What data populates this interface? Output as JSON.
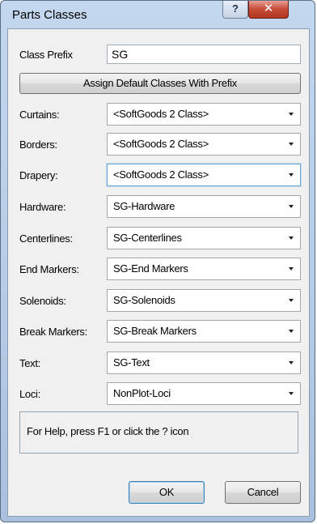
{
  "window": {
    "title": "Parts Classes",
    "help_glyph": "?",
    "close_glyph": "✕"
  },
  "prefix": {
    "label": "Class Prefix",
    "value": "SG"
  },
  "assign_button": "Assign Default Classes With Prefix",
  "rows": [
    {
      "label": "Curtains:",
      "value": "<SoftGoods 2 Class>"
    },
    {
      "label": "Borders:",
      "value": "<SoftGoods 2 Class>"
    },
    {
      "label": "Drapery:",
      "value": "<SoftGoods 2 Class>"
    },
    {
      "label": "Hardware:",
      "value": "SG-Hardware"
    },
    {
      "label": "Centerlines:",
      "value": "SG-Centerlines"
    },
    {
      "label": "End Markers:",
      "value": "SG-End Markers"
    },
    {
      "label": "Solenoids:",
      "value": "SG-Solenoids"
    },
    {
      "label": "Break Markers:",
      "value": "SG-Break Markers"
    },
    {
      "label": "Text:",
      "value": "SG-Text"
    },
    {
      "label": "Loci:",
      "value": "NonPlot-Loci"
    }
  ],
  "help_text": "For Help, press F1 or click the ? icon",
  "buttons": {
    "ok": "OK",
    "cancel": "Cancel"
  }
}
